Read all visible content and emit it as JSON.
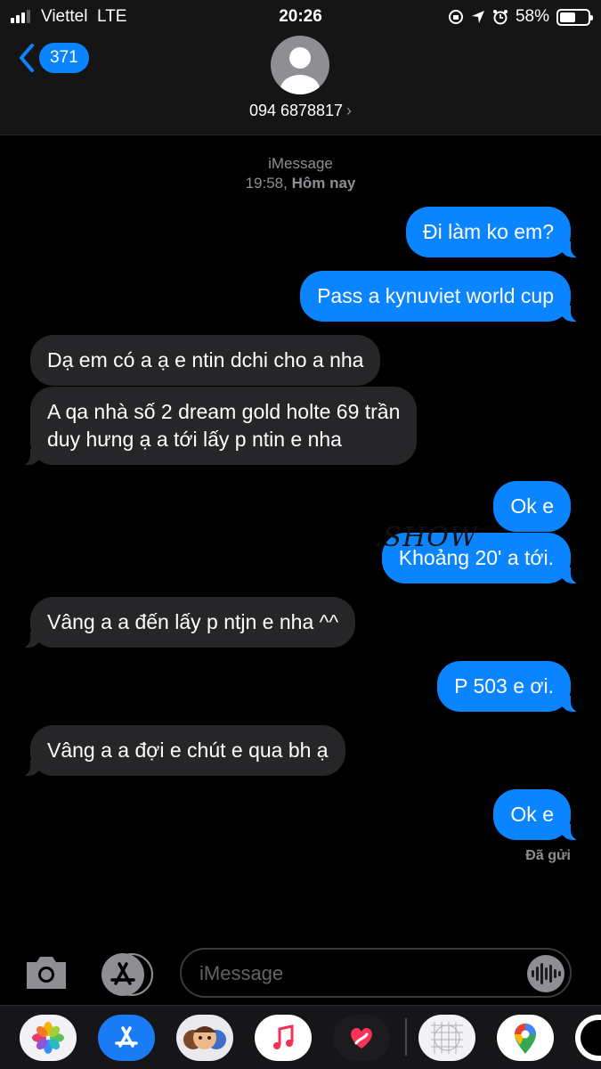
{
  "status_bar": {
    "carrier": "Viettel",
    "network": "LTE",
    "time": "20:26",
    "battery": "58%",
    "battery_level": 0.58
  },
  "header": {
    "back_count": "371",
    "contact": "094 6878817",
    "chevron": "›"
  },
  "thread": {
    "service": "iMessage",
    "timestamp_time": "19:58,",
    "timestamp_day": "Hôm nay",
    "watermark": ".SHOW",
    "messages": [
      {
        "from": "me",
        "text": "Đi làm ko em?"
      },
      {
        "from": "me",
        "text": "Pass a kynuviet world cup"
      },
      {
        "from": "them",
        "text": "Dạ em có a ạ e ntin dchi cho a nha"
      },
      {
        "from": "them",
        "lines": [
          "A qa nhà số 2 dream gold holte 69 trần",
          "duy hưng ạ a tới lấy p ntin e nha"
        ]
      },
      {
        "from": "me",
        "text": "Ok e"
      },
      {
        "from": "me",
        "text": "Khoảng 20' a tới."
      },
      {
        "from": "them",
        "text": "Vâng a a đến lấy p ntjn e nha ^^"
      },
      {
        "from": "me",
        "text": "P 503 e ơi."
      },
      {
        "from": "them",
        "text": "Vâng a a đợi e chút e qua bh ạ"
      },
      {
        "from": "me",
        "text": "Ok e"
      }
    ],
    "delivered": "Đã gửi"
  },
  "composer": {
    "placeholder": "iMessage",
    "camera_icon": "camera-icon",
    "apps_icon": "app-store-icon",
    "audio_icon": "waveform-icon"
  },
  "app_drawer": {
    "apps": [
      "photos-icon",
      "app-store-icon",
      "memoji-icon",
      "music-icon",
      "digital-touch-icon",
      "grid-app-icon",
      "google-maps-icon",
      "tiktok-icon"
    ]
  },
  "colors": {
    "outgoing": "#0a84ff",
    "incoming": "#262628",
    "background": "#000000"
  }
}
